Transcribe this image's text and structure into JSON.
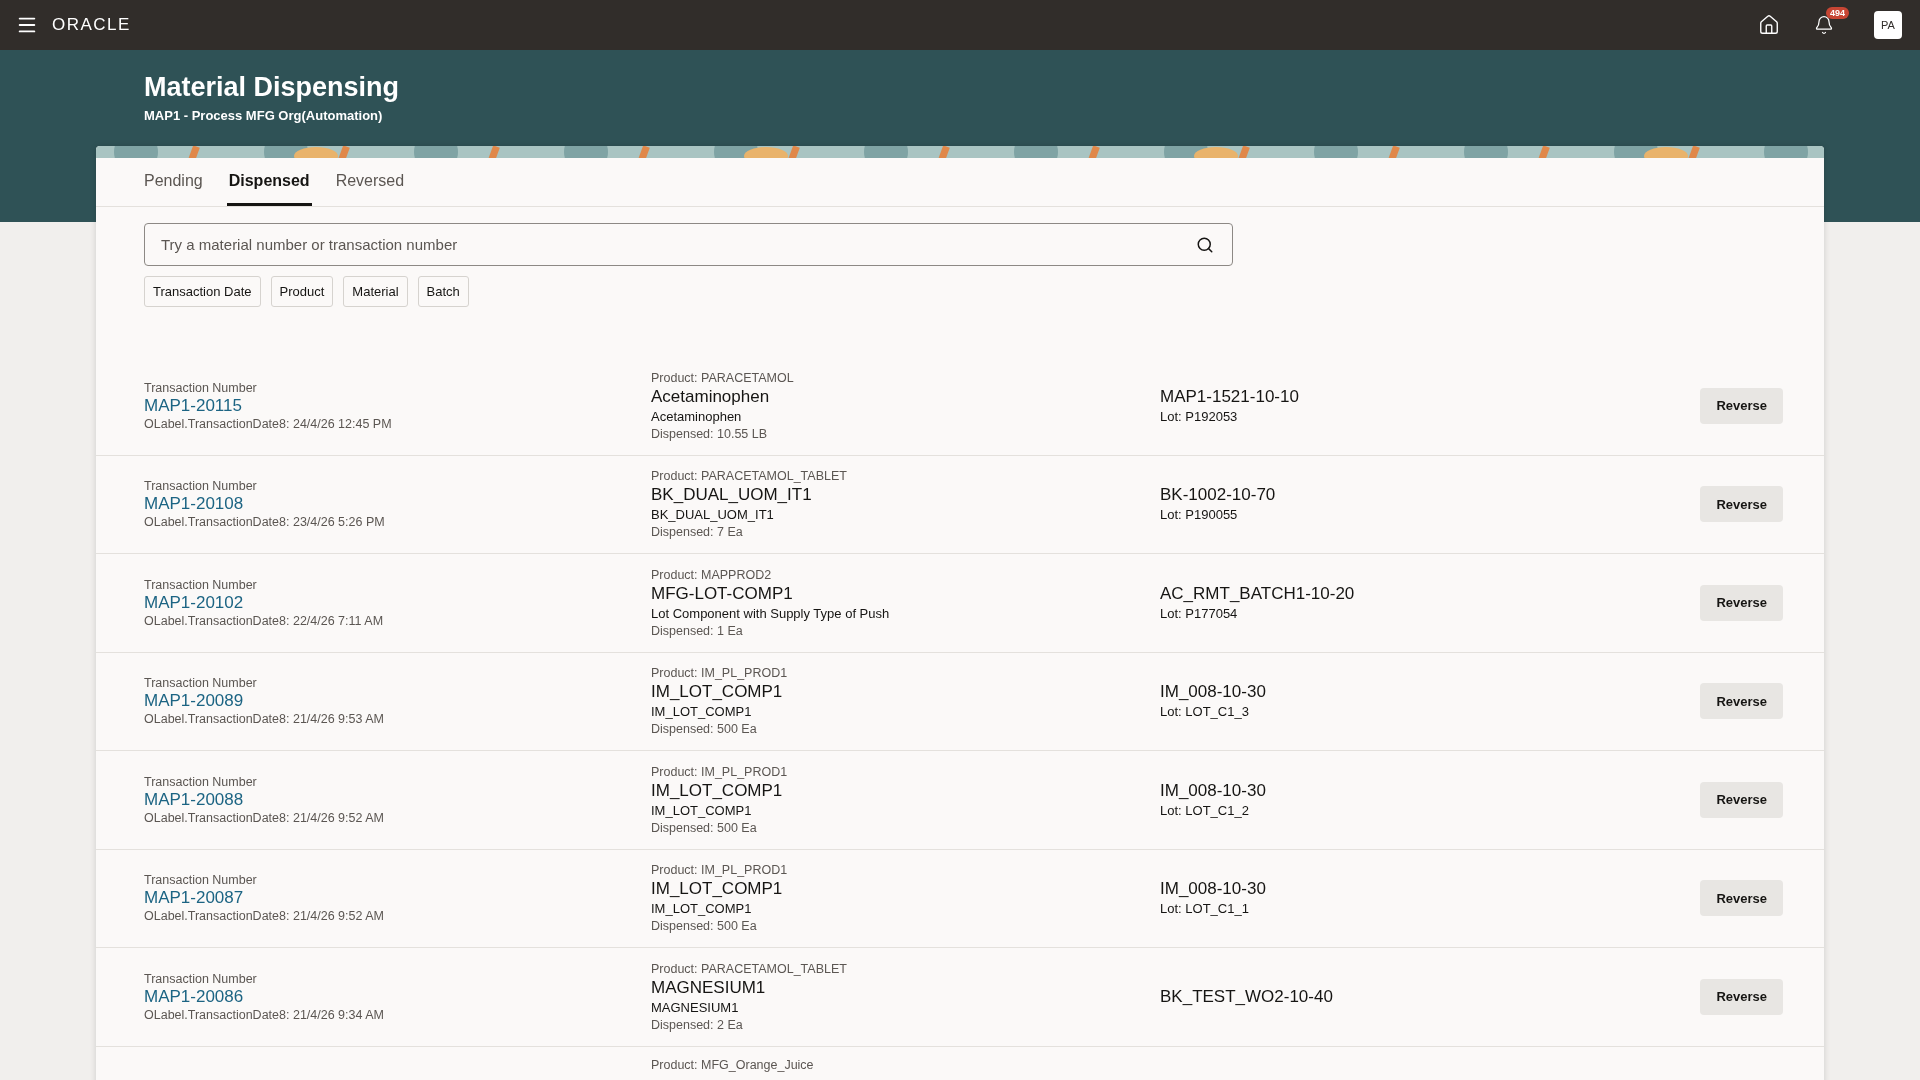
{
  "header": {
    "logo": "ORACLE",
    "notifications": "494",
    "avatar": "PA"
  },
  "page": {
    "title": "Material Dispensing",
    "subtitle": "MAP1 - Process MFG Org(Automation)"
  },
  "tabs": [
    {
      "label": "Pending",
      "selected": false
    },
    {
      "label": "Dispensed",
      "selected": true
    },
    {
      "label": "Reversed",
      "selected": false
    }
  ],
  "search": {
    "placeholder": "Try a material number or transaction number"
  },
  "filters": [
    "Transaction Date",
    "Product",
    "Material",
    "Batch"
  ],
  "transactions": [
    {
      "label": "Transaction Number",
      "number": "MAP1-20115",
      "date": "OLabel.TransactionDate8: 24/4/26 12:45 PM",
      "product": "Product: PARACETAMOL",
      "material": "Acetaminophen",
      "description": "Acetaminophen",
      "dispensed": "Dispensed: 10.55 LB",
      "batch": "MAP1-1521-10-10",
      "lot": "Lot: P192053",
      "action": "Reverse"
    },
    {
      "label": "Transaction Number",
      "number": "MAP1-20108",
      "date": "OLabel.TransactionDate8: 23/4/26 5:26 PM",
      "product": "Product: PARACETAMOL_TABLET",
      "material": "BK_DUAL_UOM_IT1",
      "description": "BK_DUAL_UOM_IT1",
      "dispensed": "Dispensed: 7 Ea",
      "batch": "BK-1002-10-70",
      "lot": "Lot: P190055",
      "action": "Reverse"
    },
    {
      "label": "Transaction Number",
      "number": "MAP1-20102",
      "date": "OLabel.TransactionDate8: 22/4/26 7:11 AM",
      "product": "Product: MAPPROD2",
      "material": "MFG-LOT-COMP1",
      "description": "Lot Component with Supply Type of Push",
      "dispensed": "Dispensed: 1 Ea",
      "batch": "AC_RMT_BATCH1-10-20",
      "lot": "Lot: P177054",
      "action": "Reverse"
    },
    {
      "label": "Transaction Number",
      "number": "MAP1-20089",
      "date": "OLabel.TransactionDate8: 21/4/26 9:53 AM",
      "product": "Product: IM_PL_PROD1",
      "material": "IM_LOT_COMP1",
      "description": "IM_LOT_COMP1",
      "dispensed": "Dispensed: 500 Ea",
      "batch": "IM_008-10-30",
      "lot": "Lot: LOT_C1_3",
      "action": "Reverse"
    },
    {
      "label": "Transaction Number",
      "number": "MAP1-20088",
      "date": "OLabel.TransactionDate8: 21/4/26 9:52 AM",
      "product": "Product: IM_PL_PROD1",
      "material": "IM_LOT_COMP1",
      "description": "IM_LOT_COMP1",
      "dispensed": "Dispensed: 500 Ea",
      "batch": "IM_008-10-30",
      "lot": "Lot: LOT_C1_2",
      "action": "Reverse"
    },
    {
      "label": "Transaction Number",
      "number": "MAP1-20087",
      "date": "OLabel.TransactionDate8: 21/4/26 9:52 AM",
      "product": "Product: IM_PL_PROD1",
      "material": "IM_LOT_COMP1",
      "description": "IM_LOT_COMP1",
      "dispensed": "Dispensed: 500 Ea",
      "batch": "IM_008-10-30",
      "lot": "Lot: LOT_C1_1",
      "action": "Reverse"
    },
    {
      "label": "Transaction Number",
      "number": "MAP1-20086",
      "date": "OLabel.TransactionDate8: 21/4/26 9:34 AM",
      "product": "Product: PARACETAMOL_TABLET",
      "material": "MAGNESIUM1",
      "description": "MAGNESIUM1",
      "dispensed": "Dispensed: 2 Ea",
      "batch": "BK_TEST_WO2-10-40",
      "action": "Reverse"
    },
    {
      "product": "Product: MFG_Orange_Juice"
    }
  ]
}
